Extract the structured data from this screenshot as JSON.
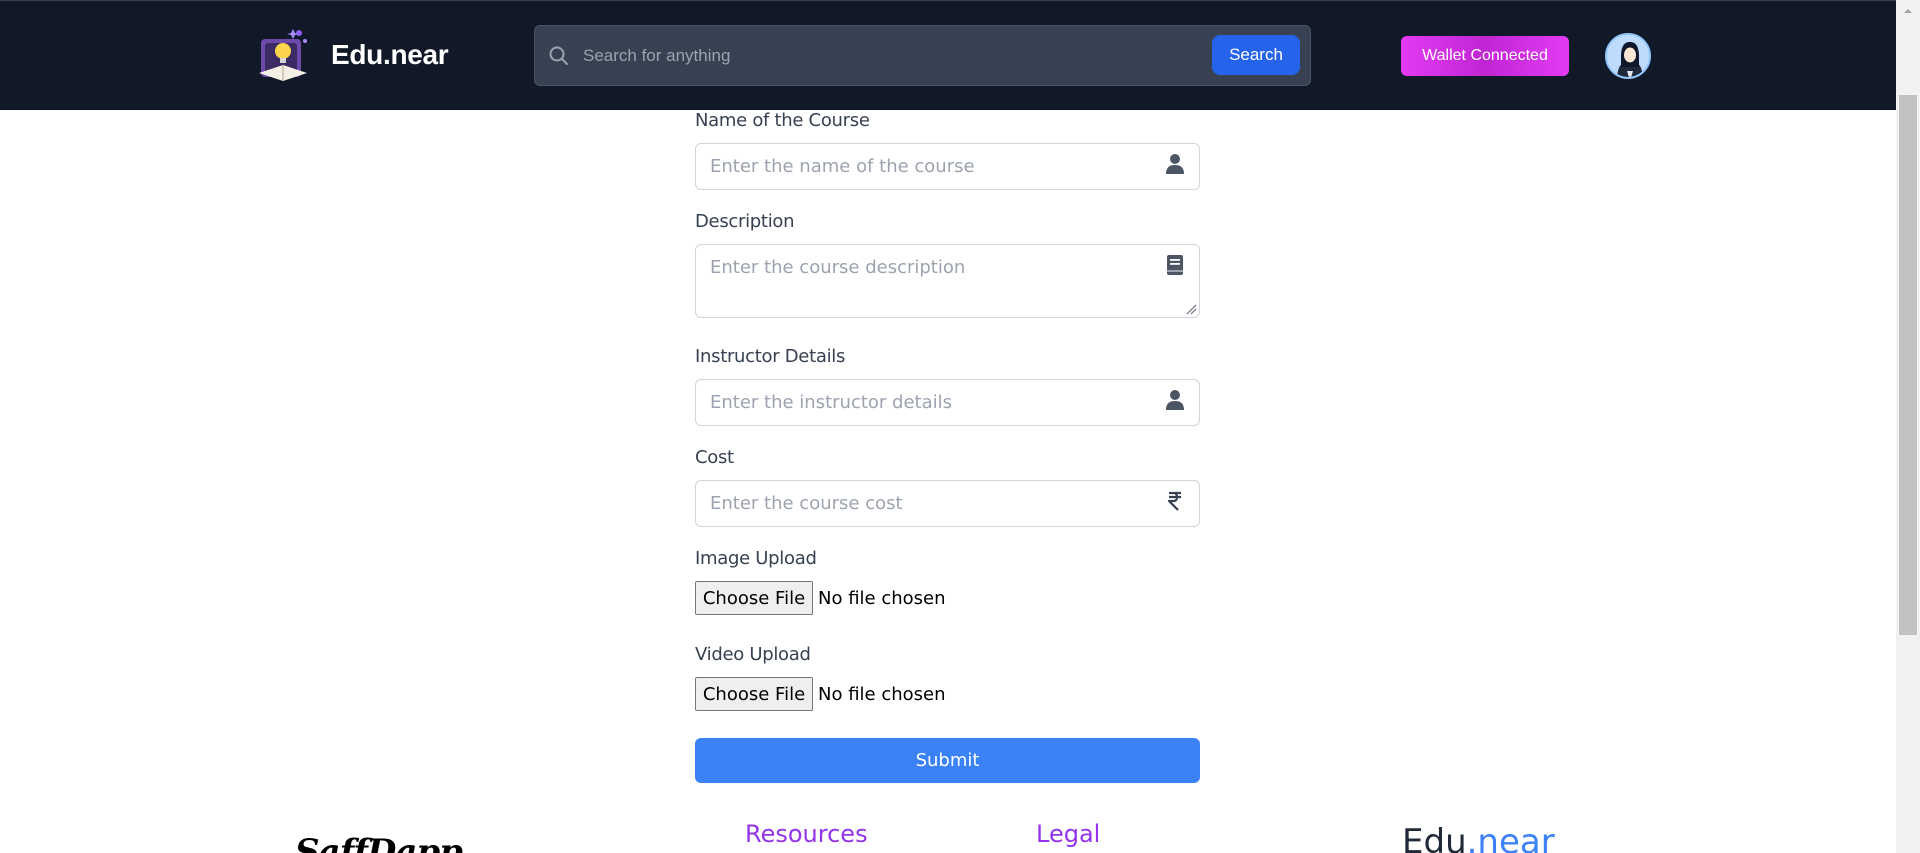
{
  "header": {
    "brand_name": "Edu.near",
    "search_placeholder": "Search for anything",
    "search_button": "Search",
    "wallet_button": "Wallet Connected"
  },
  "form": {
    "course_name": {
      "label": "Name of the Course",
      "placeholder": "Enter the name of the course",
      "icon": "user-icon"
    },
    "description": {
      "label": "Description",
      "placeholder": "Enter the course description",
      "icon": "book-icon"
    },
    "instructor": {
      "label": "Instructor Details",
      "placeholder": "Enter the instructor details",
      "icon": "user-icon"
    },
    "cost": {
      "label": "Cost",
      "placeholder": "Enter the course cost",
      "icon": "rupee-icon"
    },
    "image_upload": {
      "label": "Image Upload",
      "button": "Choose File",
      "status": "No file chosen"
    },
    "video_upload": {
      "label": "Video Upload",
      "button": "Choose File",
      "status": "No file chosen"
    },
    "submit": "Submit"
  },
  "footer": {
    "logo_text": "SaffDapp",
    "headings": [
      "Resources",
      "Legal"
    ],
    "brand_main": "Edu",
    "brand_accent": ".near"
  },
  "colors": {
    "navbar_bg": "#111827",
    "primary_blue": "#3b82f6",
    "search_blue": "#2563eb",
    "wallet_pink": "#e23bf4",
    "footer_purple": "#9333ea"
  }
}
